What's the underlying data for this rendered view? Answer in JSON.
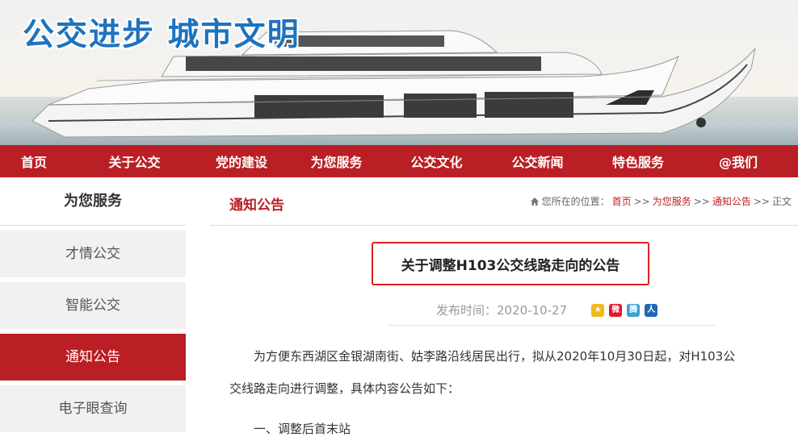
{
  "banner": {
    "title": "公交进步 城市文明"
  },
  "nav": {
    "items": [
      "首页",
      "关于公交",
      "党的建设",
      "为您服务",
      "公交文化",
      "公交新闻",
      "特色服务",
      "@我们"
    ]
  },
  "sidebar": {
    "title": "为您服务",
    "items": [
      {
        "label": "才情公交",
        "active": false
      },
      {
        "label": "智能公交",
        "active": false
      },
      {
        "label": "通知公告",
        "active": true
      },
      {
        "label": "电子眼查询",
        "active": false
      }
    ]
  },
  "main": {
    "section_title": "通知公告",
    "breadcrumb": {
      "prefix": "您所在的位置：",
      "items": [
        "首页",
        "为您服务",
        "通知公告"
      ],
      "separator": ">>",
      "current": "正文"
    },
    "article": {
      "title": "关于调整H103公交线路走向的公告",
      "published_label": "发布时间：",
      "published_date": "2020-10-27",
      "share_icons": [
        "qzone-icon",
        "weibo-icon",
        "tencent-weibo-icon",
        "renren-icon"
      ],
      "paragraph1_line1": "为方便东西湖区金银湖南街、姑李路沿线居民出行，拟从2020年10月30日起，对H103公",
      "paragraph1_line2": "交线路走向进行调整，具体内容公告如下：",
      "section1": "一、调整后首末站"
    }
  },
  "colors": {
    "brand_red": "#b91f24",
    "title_blue": "#1e73be",
    "highlight_border": "#e02020"
  }
}
